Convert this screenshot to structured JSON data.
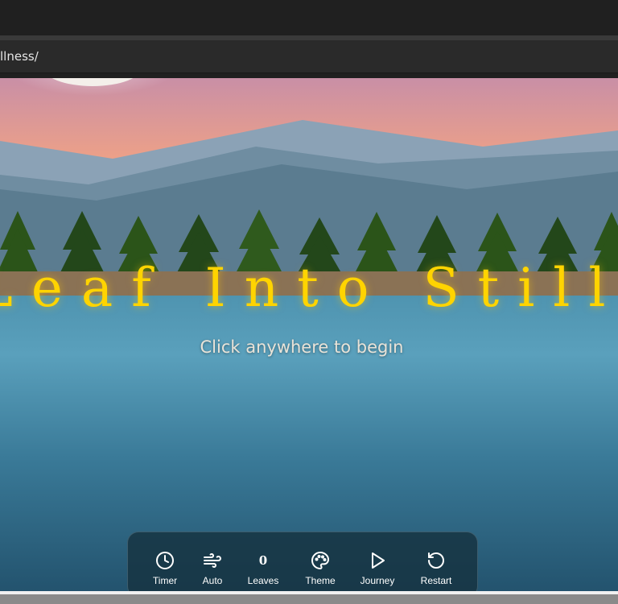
{
  "browser": {
    "url_fragment": "llness/"
  },
  "scene": {
    "title": "Leaf Into Stillness",
    "subtitle": "Click anywhere to begin"
  },
  "toolbar": {
    "leaves_count": "0",
    "items": [
      {
        "label": "Timer",
        "icon": "clock-icon"
      },
      {
        "label": "Auto",
        "icon": "wind-icon"
      },
      {
        "label": "Leaves",
        "icon": "count"
      },
      {
        "label": "Theme",
        "icon": "palette-icon"
      },
      {
        "label": "Journey",
        "icon": "play-icon"
      },
      {
        "label": "Restart",
        "icon": "restart-icon"
      }
    ]
  },
  "colors": {
    "title": "#ffd400",
    "sky_top": "#c98fa6",
    "sky_horizon": "#f2a07e",
    "lake": "#4f94b0",
    "toolbar_bg": "#163442"
  }
}
